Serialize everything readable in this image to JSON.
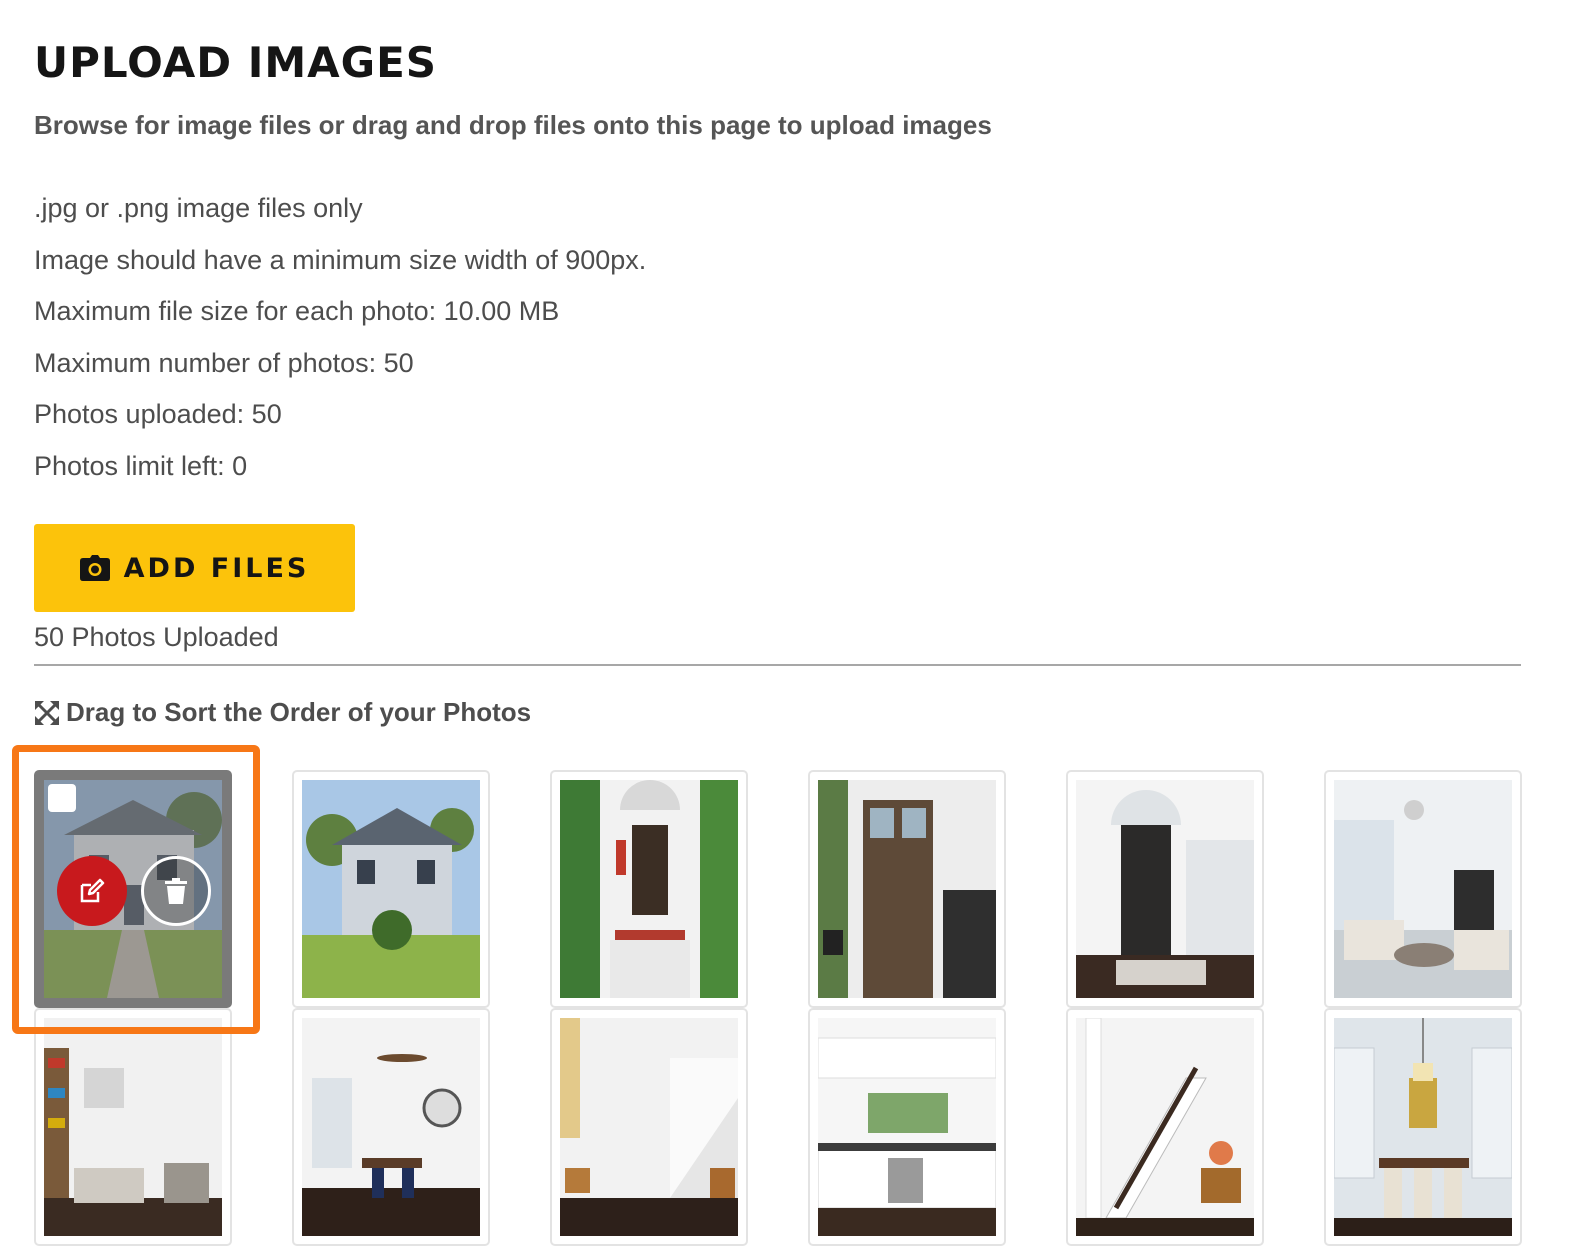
{
  "header": {
    "title": "UPLOAD IMAGES",
    "subtitle": "Browse for image files or drag and drop files onto this page to upload images"
  },
  "rules": [
    ".jpg or .png image files only",
    "Image should have a minimum size width of 900px.",
    "Maximum file size for each photo: 10.00 MB",
    "Maximum number of photos: 50",
    "Photos uploaded: 50",
    "Photos limit left: 0"
  ],
  "upload": {
    "button_label": "ADD FILES",
    "button_icon": "camera-icon",
    "uploaded_count_text": "50 Photos Uploaded"
  },
  "sort": {
    "hint": "Drag to Sort the Order of your Photos",
    "icon": "expand-arrows-icon"
  },
  "photos": [
    {
      "subject": "house-exterior-front",
      "selected": true,
      "actions": [
        "edit-icon",
        "trash-icon"
      ]
    },
    {
      "subject": "house-exterior-angle",
      "selected": false
    },
    {
      "subject": "front-porch-door-flag",
      "selected": false
    },
    {
      "subject": "front-door-glass-panels",
      "selected": false
    },
    {
      "subject": "entry-hall-dark-door",
      "selected": false
    },
    {
      "subject": "living-room-fireplace",
      "selected": false
    },
    {
      "subject": "living-room-bookshelves",
      "selected": false
    },
    {
      "subject": "dining-ceiling-fan",
      "selected": false
    },
    {
      "subject": "hallway-staircase",
      "selected": false
    },
    {
      "subject": "kitchen",
      "selected": false
    },
    {
      "subject": "staircase",
      "selected": false
    },
    {
      "subject": "dining-room-chandelier",
      "selected": false
    }
  ],
  "colors": {
    "accent": "#fcc30b",
    "edit": "#c8191d",
    "highlight": "#f77716"
  }
}
